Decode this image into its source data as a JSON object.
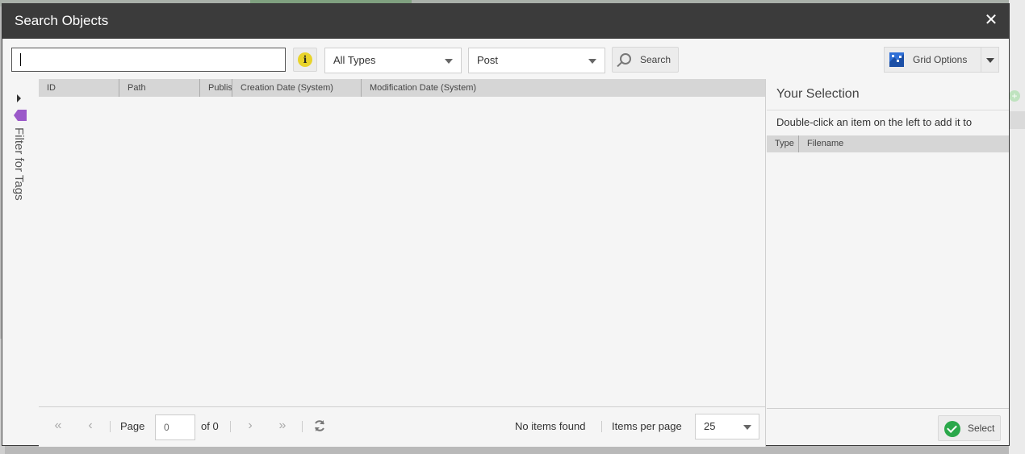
{
  "dialog": {
    "title": "Search Objects",
    "close_glyph": "✕"
  },
  "toolbar": {
    "search_value": "",
    "type_filter": "All Types",
    "class_filter": "Post",
    "search_label": "Search",
    "grid_options_label": "Grid Options",
    "info_glyph": "i"
  },
  "tag_filter": {
    "label": "Filter for Tags"
  },
  "grid": {
    "columns": [
      "ID",
      "Path",
      "Publis",
      "Creation Date (System)",
      "Modification Date (System)"
    ]
  },
  "paging": {
    "page_label": "Page",
    "page_value": "0",
    "of_label": "of 0",
    "status": "No items found",
    "items_per_page_label": "Items per page",
    "items_per_page": "25",
    "first_glyph": "«",
    "prev_glyph": "‹",
    "next_glyph": "›",
    "last_glyph": "»"
  },
  "selection": {
    "title": "Your Selection",
    "hint": "Double-click an item on the left to add it to",
    "columns": [
      "Type",
      "Filename"
    ],
    "select_label": "Select"
  },
  "colors": {
    "title_bar": "#3b3b3b",
    "info_icon": "#e8d32a",
    "tag_icon": "#9b59c9",
    "select_check": "#2aa84a"
  }
}
